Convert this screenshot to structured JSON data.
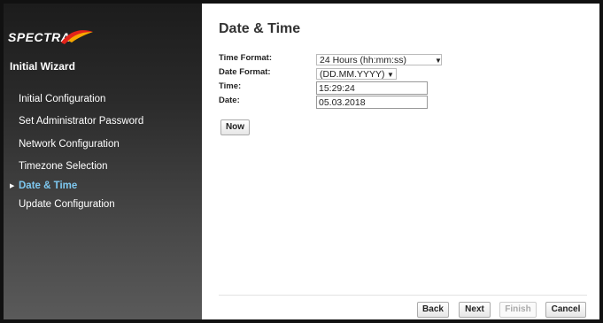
{
  "brand": {
    "logo_text": "SPECTRA"
  },
  "sidebar": {
    "title": "Initial Wizard",
    "items": [
      {
        "label": "Initial Configuration"
      },
      {
        "label": "Set Administrator Password"
      },
      {
        "label": "Network Configuration"
      },
      {
        "label": "Timezone Selection"
      },
      {
        "label": "Date & Time",
        "active": true
      },
      {
        "label": "Update Configuration"
      }
    ]
  },
  "main": {
    "title": "Date & Time",
    "time_format": {
      "label": "Time Format:",
      "value": "24 Hours (hh:mm:ss)"
    },
    "date_format": {
      "label": "Date Format:",
      "value": "(DD.MM.YYYY)"
    },
    "time": {
      "label": "Time:",
      "value": "15:29:24"
    },
    "date": {
      "label": "Date:",
      "value": "05.03.2018"
    },
    "now_label": "Now"
  },
  "footer": {
    "back_label": "Back",
    "next_label": "Next",
    "finish_label": "Finish",
    "cancel_label": "Cancel"
  },
  "colors": {
    "active_nav": "#7ec8f0",
    "logo_swoosh_red": "#e2231a",
    "logo_swoosh_yellow": "#f7a800"
  }
}
